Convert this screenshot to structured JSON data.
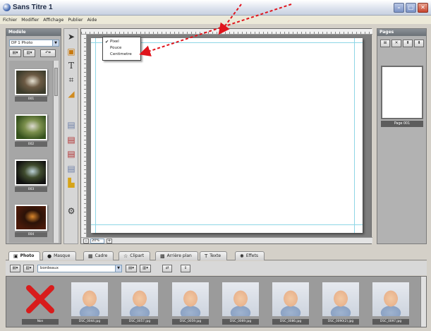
{
  "window": {
    "title": "Sans Titre 1"
  },
  "menu": [
    "Fichier",
    "Modifier",
    "Affichage",
    "Publier",
    "Aide"
  ],
  "left_panel": {
    "heading": "Modèle",
    "selected_model": "DP 1 Photo",
    "models": [
      {
        "label": "001",
        "colors": [
          "#3b3b2b",
          "#e5e0d0",
          "#6c5a43"
        ]
      },
      {
        "label": "002",
        "colors": [
          "#36521e",
          "#dcdad0",
          "#7b8f4c"
        ]
      },
      {
        "label": "003",
        "colors": [
          "#111111",
          "#bcd1d8",
          "#404c2e"
        ]
      },
      {
        "label": "004",
        "colors": [
          "#4a1a0a",
          "#d9862c",
          "#2b1208"
        ]
      }
    ]
  },
  "canvas": {
    "zoom": "20%"
  },
  "unit_menu": [
    {
      "label": "Pixel",
      "checked": true
    },
    {
      "label": "Pouce",
      "checked": false
    },
    {
      "label": "Centimetre",
      "checked": false
    }
  ],
  "pages_panel": {
    "heading": "Pages",
    "page_label": "Page 001"
  },
  "tabs": [
    {
      "label": "Photo",
      "icon": "camera-icon",
      "active": true
    },
    {
      "label": "Masque",
      "icon": "mask-icon",
      "active": false
    },
    {
      "label": "Cadre",
      "icon": "frame-icon",
      "active": false
    },
    {
      "label": "Clipart",
      "icon": "clipart-icon",
      "active": false
    },
    {
      "label": "Arrière plan",
      "icon": "background-icon",
      "active": false
    },
    {
      "label": "Texte",
      "icon": "text-icon",
      "active": false
    },
    {
      "label": "Effets",
      "icon": "effects-icon",
      "active": false
    }
  ],
  "photo_browser": {
    "folder": "bordeaux",
    "photos": [
      {
        "label": "Non",
        "kind": "none"
      },
      {
        "label": "DSC_0044.jpg",
        "kind": "photo"
      },
      {
        "label": "DSC_0057.jpg",
        "kind": "photo"
      },
      {
        "label": "DSC_0059.jpg",
        "kind": "photo"
      },
      {
        "label": "DSC_0069.jpg",
        "kind": "photo"
      },
      {
        "label": "DSC_0086.jpg",
        "kind": "photo"
      },
      {
        "label": "DSC_0090(2).jpg",
        "kind": "photo"
      },
      {
        "label": "DSC_0097.jpg",
        "kind": "photo"
      }
    ]
  }
}
